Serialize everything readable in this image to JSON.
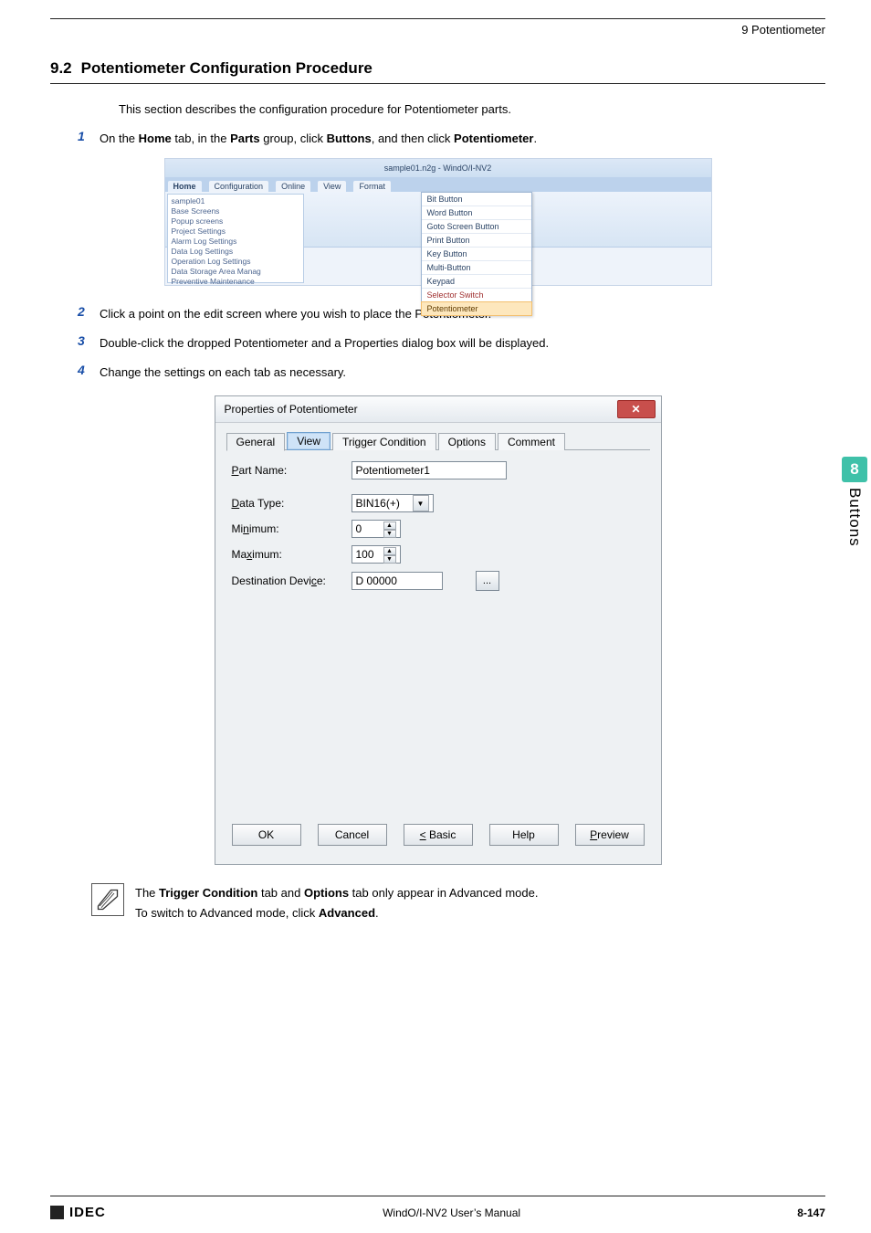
{
  "page_top": "9 Potentiometer",
  "section": {
    "num": "9.2",
    "title": "Potentiometer Configuration Procedure"
  },
  "intro": "This section describes the configuration procedure for Potentiometer parts.",
  "steps": {
    "s1": {
      "pre": "On the ",
      "home": "Home",
      "t1": " tab, in the ",
      "parts": "Parts",
      "t2": " group, click ",
      "buttons": "Buttons",
      "t3": ", and then click ",
      "pot": "Potentiometer",
      "t4": "."
    },
    "s2": "Click a point on the edit screen where you wish to place the Potentiometer.",
    "s3": "Double-click the dropped Potentiometer and a Properties dialog box will be displayed.",
    "s4": "Change the settings on each tab as necessary."
  },
  "ribbon": {
    "title": "sample01.n2g - WindO/I-NV2",
    "tabs": [
      "Home",
      "Configuration",
      "Online",
      "View",
      "Format"
    ],
    "tree": [
      "sample01",
      " Base Screens",
      " Popup screens",
      " Project Settings",
      " Alarm Log Settings",
      " Data Log Settings",
      " Operation Log Settings",
      " Data Storage Area Manag",
      " Preventive Maintenance"
    ],
    "menu": [
      "Bit Button",
      "Word Button",
      "Goto Screen Button",
      "Print Button",
      "Key Button",
      "Multi-Button",
      "Keypad",
      "Selector Switch",
      "Potentiometer"
    ]
  },
  "dialog": {
    "title": "Properties of Potentiometer",
    "tabs": [
      "General",
      "View",
      "Trigger Condition",
      "Options",
      "Comment"
    ],
    "part_name_label": "Part Name:",
    "part_name_value": "Potentiometer1",
    "data_type_label_full": "Data Type:",
    "data_type_value": "BIN16(+)",
    "min_label_full": "Minimum:",
    "min_value": "0",
    "max_label_full": "Maximum:",
    "max_value": "100",
    "dest_label_full": "Destination Device:",
    "dest_value": "D 00000",
    "buttons": {
      "ok": "OK",
      "cancel": "Cancel",
      "basic": "< Basic",
      "help": "Help",
      "preview": "Preview"
    }
  },
  "note": {
    "l1a": "The ",
    "l1b": "Trigger Condition",
    "l1c": " tab and ",
    "l1d": "Options",
    "l1e": " tab only appear in Advanced mode.",
    "l2a": "To switch to Advanced mode, click ",
    "l2b": "Advanced",
    "l2c": "."
  },
  "side": {
    "num": "8",
    "label": "Buttons"
  },
  "footer": {
    "logo": "IDEC",
    "center": "WindO/I-NV2 User’s Manual",
    "page": "8-147"
  }
}
